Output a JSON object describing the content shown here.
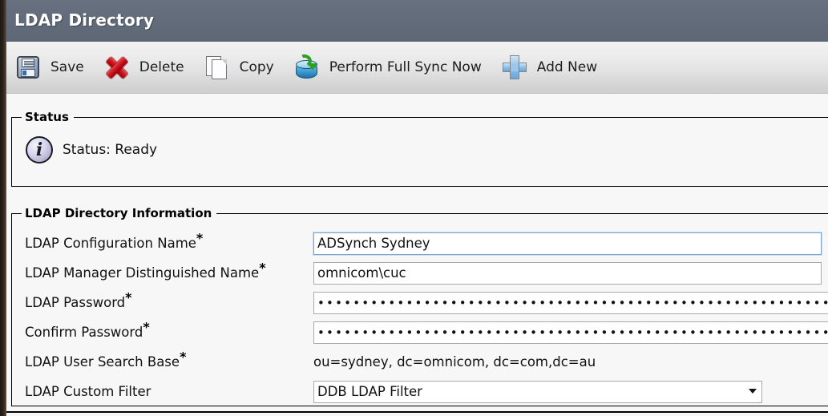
{
  "header": {
    "title": "LDAP Directory"
  },
  "toolbar": {
    "items": [
      {
        "label": "Save",
        "icon": "save-icon"
      },
      {
        "label": "Delete",
        "icon": "delete-icon"
      },
      {
        "label": "Copy",
        "icon": "copy-icon"
      },
      {
        "label": "Perform Full Sync Now",
        "icon": "sync-icon"
      },
      {
        "label": "Add New",
        "icon": "add-icon"
      }
    ]
  },
  "status_section": {
    "legend": "Status",
    "icon": "info-icon",
    "text": "Status: Ready"
  },
  "ldap_section": {
    "legend": "LDAP Directory Information",
    "required_marker": "*",
    "fields": [
      {
        "label": "LDAP Configuration Name",
        "required": true,
        "type": "text",
        "value": "ADSynch Sydney",
        "placeholder": ""
      },
      {
        "label": "LDAP Manager Distinguished Name",
        "required": true,
        "type": "text",
        "value": "omnicom\\cuc",
        "placeholder": ""
      },
      {
        "label": "LDAP Password",
        "required": true,
        "type": "password",
        "value": "••••••••••••••••••••••••••••••••••••••••••••••••••••••••••••••••",
        "placeholder": ""
      },
      {
        "label": "Confirm Password",
        "required": true,
        "type": "password",
        "value": "••••••••••••••••••••••••••••••••••••••••••••••••••••••••••••••••",
        "placeholder": ""
      },
      {
        "label": "LDAP User Search Base",
        "required": true,
        "type": "static",
        "value": "ou=sydney, dc=omnicom, dc=com,dc=au",
        "placeholder": ""
      },
      {
        "label": "LDAP Custom Filter",
        "required": false,
        "type": "select",
        "value": "DDB LDAP Filter",
        "options": [
          "DDB LDAP Filter"
        ]
      }
    ]
  },
  "colors": {
    "header_bg": "#616b7a",
    "toolbar_bg": "#e4e4e5",
    "page_bg": "#f7f7f7",
    "fieldset_border": "#000000",
    "input_border": "#a9a9a9",
    "focus_border": "#7aa7d6",
    "delete_icon": "#c9141c",
    "sync_arrow": "#2f9e21",
    "add_icon": "#8fc0e8"
  }
}
